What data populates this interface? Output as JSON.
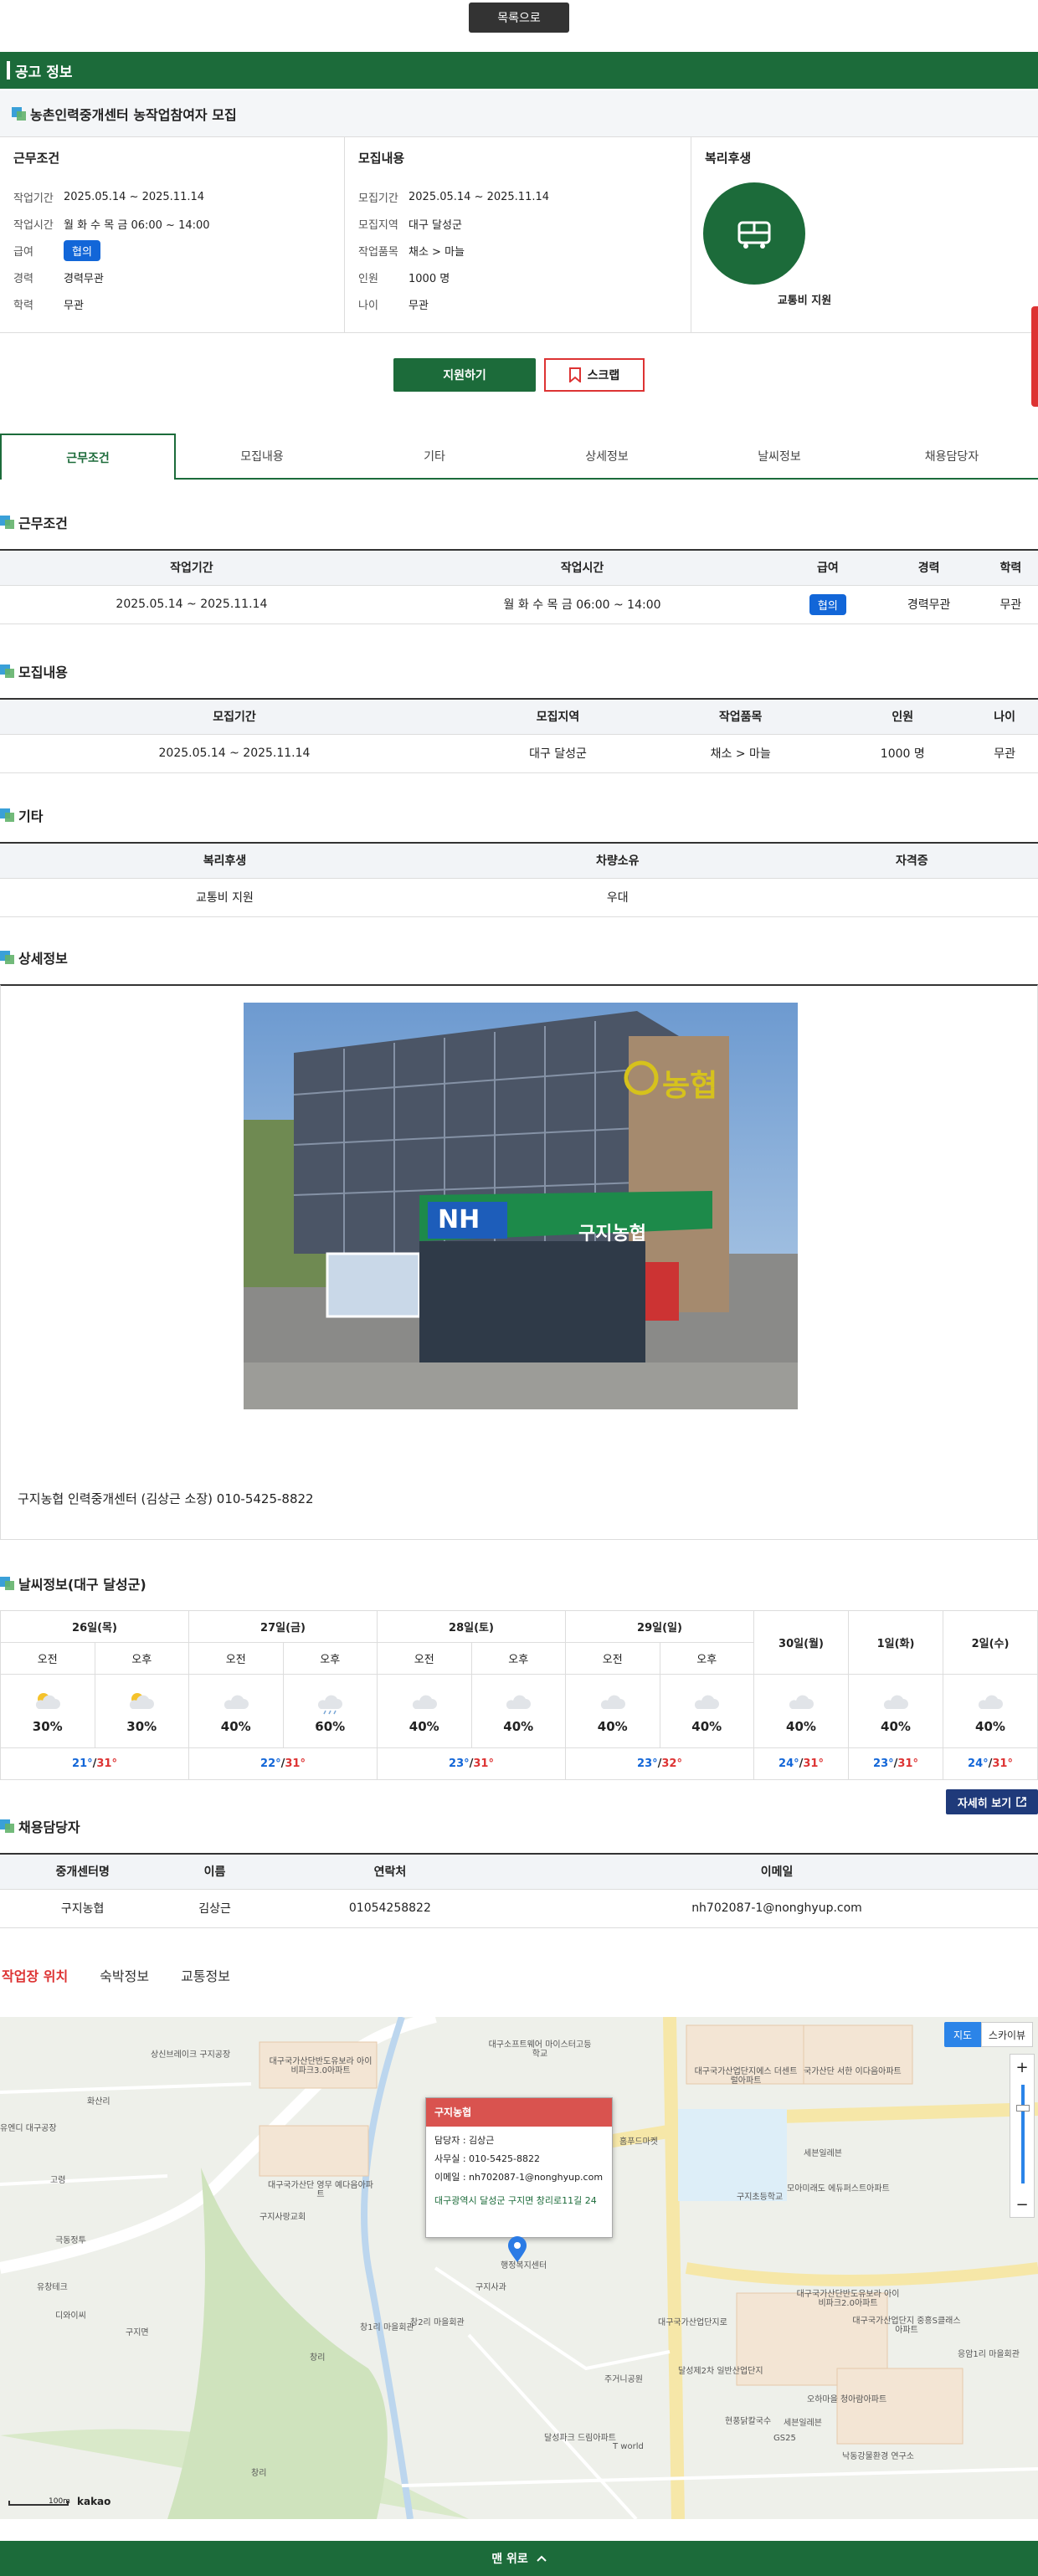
{
  "top_button": "목록으로",
  "section_bar": "공고 정보",
  "job_title": "농촌인력중개센터 농작업참여자 모집",
  "work": {
    "title": "근무조건",
    "rows": [
      {
        "k": "작업기간",
        "v": "2025.05.14 ~ 2025.11.14"
      },
      {
        "k": "작업시간",
        "v": "월 화 수 목 금   06:00 ~ 14:00"
      },
      {
        "k": "급여",
        "v": "협의"
      },
      {
        "k": "경력",
        "v": "경력무관"
      },
      {
        "k": "학력",
        "v": "무관"
      }
    ]
  },
  "recruit": {
    "title": "모집내용",
    "rows": [
      {
        "k": "모집기간",
        "v": "2025.05.14 ~ 2025.11.14"
      },
      {
        "k": "모집지역",
        "v": "대구 달성군"
      },
      {
        "k": "작업품목",
        "v": "채소 > 마늘"
      },
      {
        "k": "인원",
        "v": "1000 명"
      },
      {
        "k": "나이",
        "v": "무관"
      }
    ]
  },
  "welfare": {
    "title": "복리후생",
    "label": "교통비 지원"
  },
  "apply_label": "지원하기",
  "scrap_label": "스크랩",
  "tabs": [
    "근무조건",
    "모집내용",
    "기타",
    "상세정보",
    "날씨정보",
    "채용담당자"
  ],
  "sec_work": {
    "title": "근무조건",
    "headers": [
      "작업기간",
      "작업시간",
      "급여",
      "경력",
      "학력"
    ],
    "row": [
      "2025.05.14 ~ 2025.11.14",
      "월 화 수 목 금   06:00 ~ 14:00",
      "협의",
      "경력무관",
      "무관"
    ]
  },
  "sec_recruit": {
    "title": "모집내용",
    "headers": [
      "모집기간",
      "모집지역",
      "작업품목",
      "인원",
      "나이"
    ],
    "row": [
      "2025.05.14 ~ 2025.11.14",
      "대구 달성군",
      "채소 > 마늘",
      "1000 명",
      "무관"
    ]
  },
  "sec_etc": {
    "title": "기타",
    "headers": [
      "복리후생",
      "차량소유",
      "자격증"
    ],
    "row": [
      "교통비 지원",
      "우대",
      ""
    ]
  },
  "sec_detail": {
    "title": "상세정보",
    "text": "구지농협 인력중개센터 (김상근 소장) 010-5425-8822",
    "sign_text": "구지농협",
    "nh_text": "NH",
    "sign_top": "농협"
  },
  "weather": {
    "title": "날씨정보(대구 달성군)",
    "days": [
      {
        "day": "26일(목)",
        "am": "오전",
        "pm": "오후",
        "am_pct": "30%",
        "pm_pct": "30%",
        "lo": "21°",
        "hi": "31°",
        "am_icon": "sun-cloud",
        "pm_icon": "sun-cloud"
      },
      {
        "day": "27일(금)",
        "am": "오전",
        "pm": "오후",
        "am_pct": "40%",
        "pm_pct": "60%",
        "lo": "22°",
        "hi": "31°",
        "am_icon": "cloud",
        "pm_icon": "rain-cloud"
      },
      {
        "day": "28일(토)",
        "am": "오전",
        "pm": "오후",
        "am_pct": "40%",
        "pm_pct": "40%",
        "lo": "23°",
        "hi": "31°",
        "am_icon": "cloud",
        "pm_icon": "cloud"
      },
      {
        "day": "29일(일)",
        "am": "오전",
        "pm": "오후",
        "am_pct": "40%",
        "pm_pct": "40%",
        "lo": "23°",
        "hi": "32°",
        "am_icon": "cloud",
        "pm_icon": "cloud"
      }
    ],
    "single": [
      {
        "day": "30일(월)",
        "pct": "40%",
        "lo": "24°",
        "hi": "31°"
      },
      {
        "day": "1일(화)",
        "pct": "40%",
        "lo": "23°",
        "hi": "31°"
      },
      {
        "day": "2일(수)",
        "pct": "40%",
        "lo": "24°",
        "hi": "31°"
      }
    ],
    "slash": "/",
    "more": "자세히 보기"
  },
  "contact": {
    "title": "채용담당자",
    "headers": [
      "중개센터명",
      "이름",
      "연락처",
      "이메일"
    ],
    "row": [
      "구지농협",
      "김상근",
      "01054258822",
      "nh702087-1@nonghyup.com"
    ]
  },
  "map_tabs": [
    "작업장 위치",
    "숙박정보",
    "교통정보"
  ],
  "map": {
    "popup_title": "구지농협",
    "popup_lines": [
      "담당자 : 김상근",
      "사무실 : 010-5425-8822",
      "이메일 : nh702087-1@nonghyup.com"
    ],
    "popup_addr": "대구광역시 달성군 구지면 창리로11길 24",
    "btn_map": "지도",
    "btn_sky": "스카이뷰",
    "zoom_in": "+",
    "zoom_out": "−",
    "scale": "100m",
    "brand": "kakao",
    "labels": [
      "상신브레이크 구지공장",
      "대구국가산단반도유보라 아이비파크3.0아파트",
      "대구국가산업단지에스 더센트럴아파트",
      "국가산단 서한 이다음아파트",
      "대구소프트웨어 마이스터고등학교",
      "화산리",
      "유엔디 대구공장",
      "고령",
      "대구국가산단 영무 예다음아파트",
      "구지사랑교회",
      "구지초등학교",
      "세븐일레븐",
      "모아미래도 에듀퍼스트아파트",
      "극동정투",
      "유창테크",
      "디와이씨",
      "구지면",
      "창1리 마을회관",
      "창리",
      "창2리 마을회관",
      "홈푸드마켓",
      "대구국가산단반도유보라 아이비파크2.0아파트",
      "대구국가산업단지 중흥S클래스아파트",
      "응암1리 마을회관",
      "오하마을 청아람아파트",
      "세븐일레븐",
      "주거니공원",
      "현풍닭칼국수",
      "GS25",
      "달성제2차 일반산업단지",
      "달성파크 드림아파트",
      "T world",
      "낙동강물환경 연구소",
      "창리",
      "대구국가산업단지로",
      "구지사과",
      "행정복지센터"
    ]
  },
  "footer": "맨 위로"
}
